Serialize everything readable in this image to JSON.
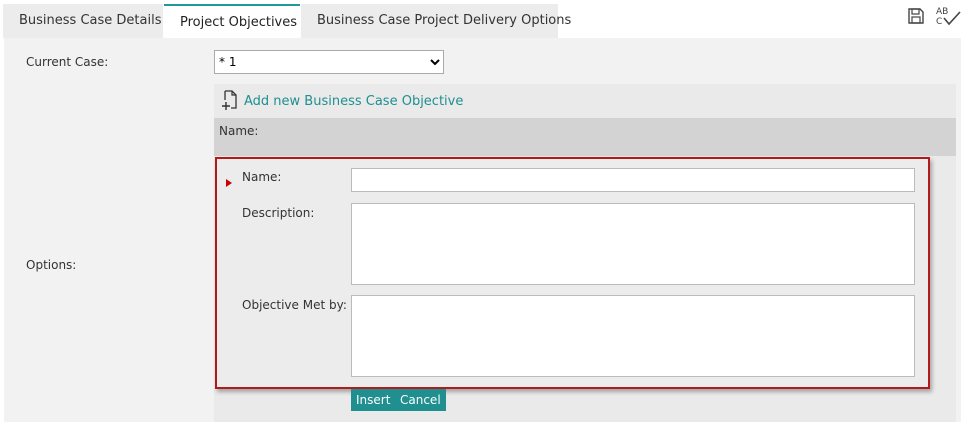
{
  "tabs": [
    {
      "label": "Business Case Details"
    },
    {
      "label": "Project Objectives"
    },
    {
      "label": "Business Case Project Delivery Options"
    }
  ],
  "toolbar": {
    "save_icon": "save-icon",
    "spellcheck_icon": "spellcheck-icon",
    "spellcheck_text": "AB C"
  },
  "current_case": {
    "label": "Current Case:",
    "value": "* 1"
  },
  "options": {
    "label": "Options:"
  },
  "add_objective": {
    "label": "Add new Business Case Objective",
    "icon": "add-document-icon"
  },
  "grid": {
    "column_header": "Name:"
  },
  "form": {
    "name_label": "Name:",
    "name_value": "",
    "description_label": "Description:",
    "description_value": "",
    "objective_met_label": "Objective Met by:",
    "objective_met_value": ""
  },
  "buttons": {
    "insert": "Insert",
    "cancel": "Cancel"
  },
  "colors": {
    "accent": "#1f8f8f",
    "highlight_border": "#b31b1b",
    "required_marker": "#cc0000"
  }
}
